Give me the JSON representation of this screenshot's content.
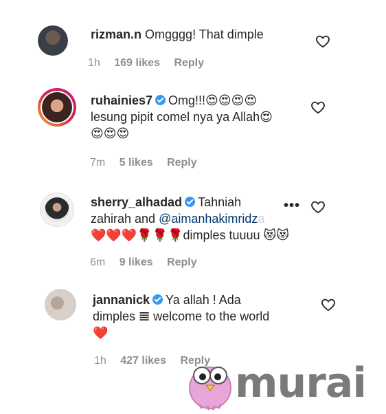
{
  "comments": [
    {
      "username": "rizman.n",
      "verified": false,
      "text": "Omgggg! That dimple",
      "time": "1h",
      "likes": "169 likes",
      "reply": "Reply"
    },
    {
      "username": "ruhainies7",
      "verified": true,
      "text_line1": "Omg!!!😍😍😍😍",
      "text_line2": "lesung pipit comel nya ya Allah😍",
      "text_line3": "😍😍😍",
      "time": "7m",
      "likes": "5 likes",
      "reply": "Reply"
    },
    {
      "username": "sherry_alhadad",
      "verified": true,
      "text_line1": "Tahniah",
      "text_line2_a": "zahirah and ",
      "mention": "@aimanhakimridz",
      "mention_fade": "a",
      "text_line3": "❤️❤️❤️🌹🌹🌹dimples tuuuu 😻😻",
      "time": "6m",
      "likes": "9 likes",
      "reply": "Reply",
      "more": "•••"
    },
    {
      "username": "jannanick",
      "verified": true,
      "text_line1": "Ya allah ! Ada",
      "text_line2": "dimples 𝌆 welcome to the world",
      "text_line3": "❤️",
      "time": "1h",
      "likes": "427 likes",
      "reply": "Reply"
    }
  ],
  "watermark": {
    "word": "murai",
    "mascot": "owl-mascot"
  },
  "colors": {
    "text": "#262626",
    "meta": "#8e8e8e",
    "verified": "#3897f0",
    "mention": "#00376b"
  }
}
